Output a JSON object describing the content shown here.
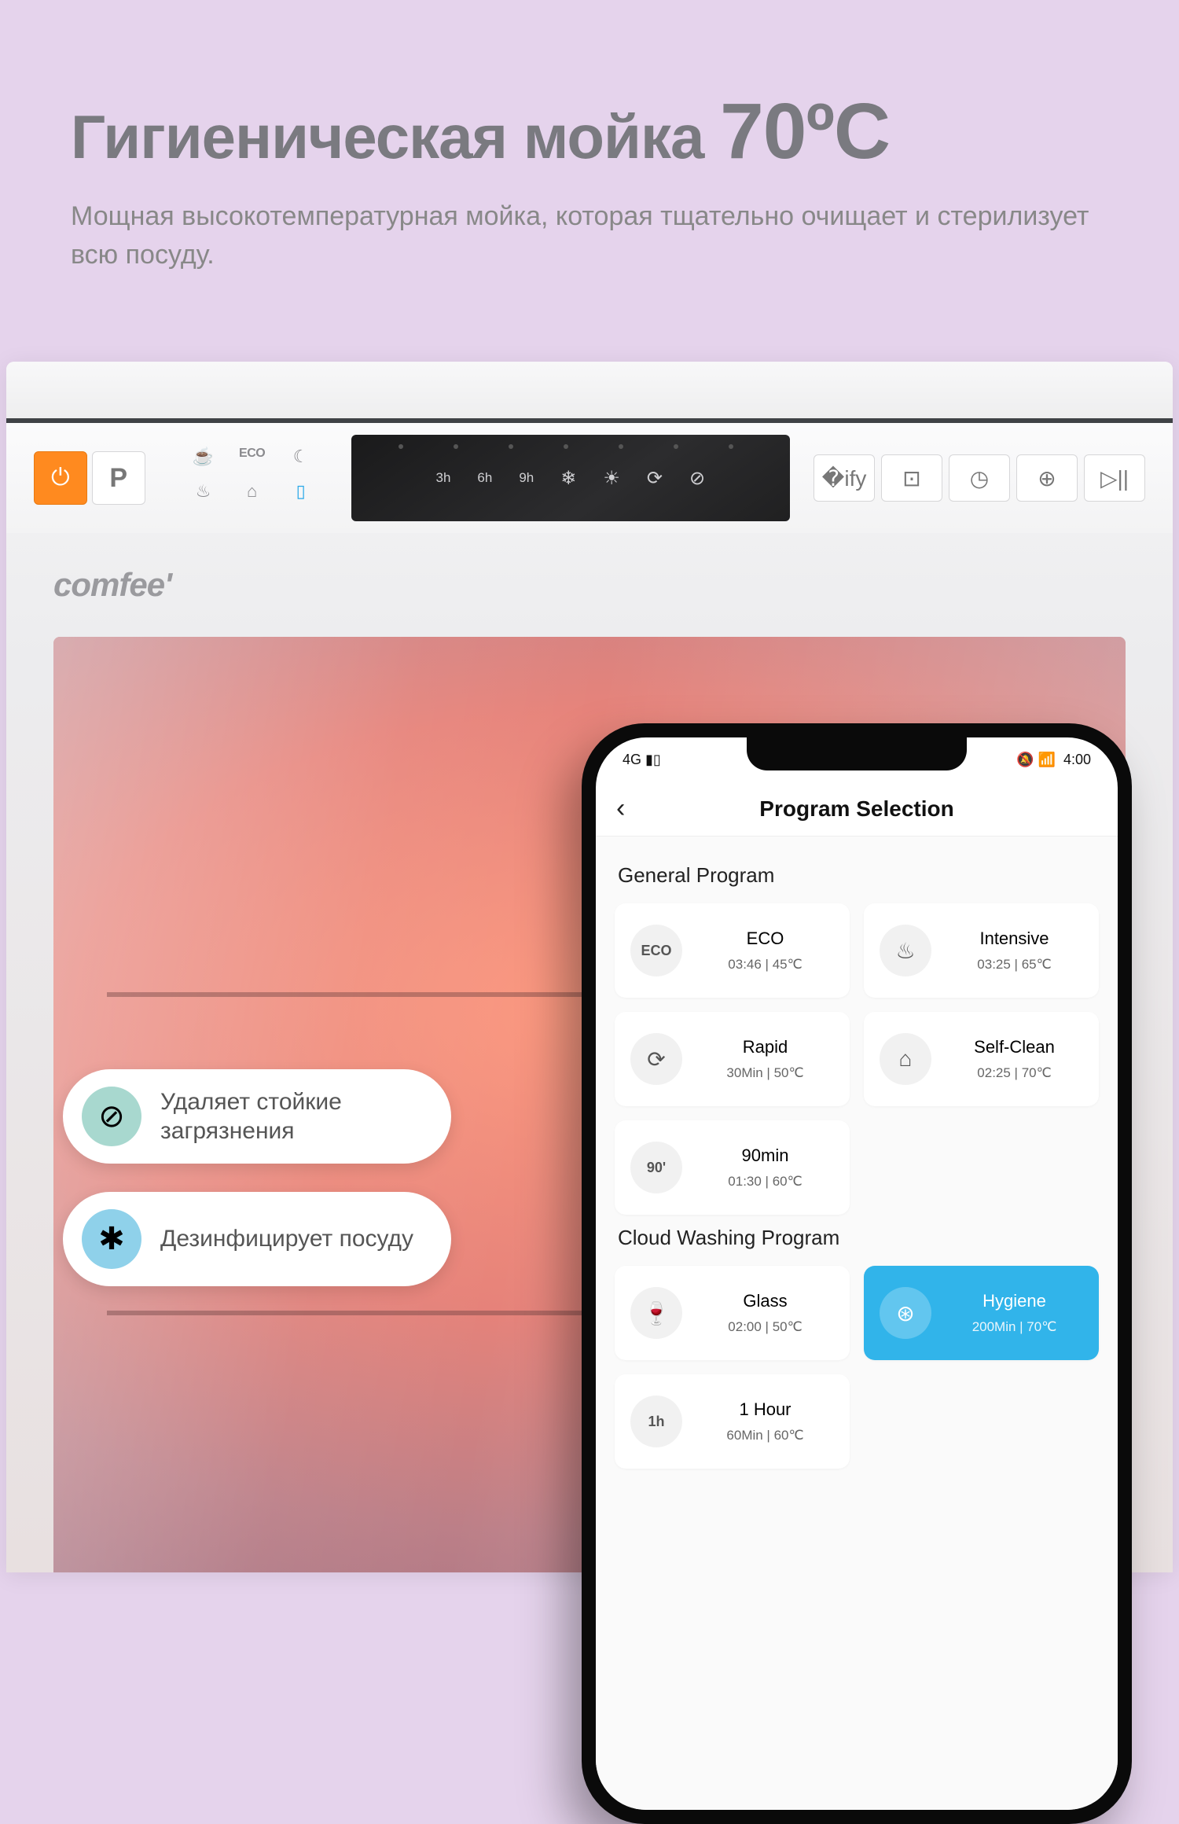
{
  "hero": {
    "title_main": "Гигиеническая мойка",
    "title_temp": "70ºC",
    "description": "Мощная высокотемпературная мойка, которая тщательно очищает и стерилизует всю посуду."
  },
  "appliance": {
    "brand": "comfee'",
    "power_icon": "⏻",
    "p_label": "P",
    "icons": {
      "eco": "ECO",
      "cup": "☕",
      "moon": "☾",
      "pot": "♨",
      "basket": "⌂",
      "phone": "▯"
    },
    "display_labels": [
      "3h",
      "6h",
      "9h",
      "❄",
      "☀",
      "⟳",
      "⊘"
    ],
    "right_buttons": [
      "�ify",
      "⊡",
      "◷",
      "⊕",
      "▷||"
    ]
  },
  "pills": [
    {
      "icon_color": "#a8d8cf",
      "icon": "⊘",
      "text": "Удаляет стойкие\nзагрязнения"
    },
    {
      "icon_color": "#8fd1ea",
      "icon": "✱",
      "text": "Дезинфицирует посуду"
    }
  ],
  "phone": {
    "status_left": "4G ▮▯",
    "status_right_icons": "🔕 📶",
    "status_time": "4:00",
    "back": "‹",
    "header": "Program Selection",
    "sections": [
      {
        "title": "General Program",
        "programs": [
          {
            "icon": "ECO",
            "icon_class": "ecot",
            "name": "ECO",
            "detail": "03:46 | 45℃"
          },
          {
            "icon": "♨",
            "name": "Intensive",
            "detail": "03:25 | 65℃"
          },
          {
            "icon": "⟳",
            "name": "Rapid",
            "detail": "30Min | 50℃"
          },
          {
            "icon": "⌂",
            "name": "Self-Clean",
            "detail": "02:25 | 70℃"
          },
          {
            "icon": "90'",
            "icon_class": "ecot",
            "name": "90min",
            "detail": "01:30 | 60℃"
          },
          {
            "empty": true
          }
        ]
      },
      {
        "title": "Cloud Washing Program",
        "programs": [
          {
            "icon": "🍷",
            "name": "Glass",
            "detail": "02:00 | 50℃"
          },
          {
            "icon": "⊛",
            "name": "Hygiene",
            "detail": "200Min | 70℃",
            "selected": true
          },
          {
            "icon": "1h",
            "icon_class": "ecot",
            "name": "1 Hour",
            "detail": "60Min | 60℃"
          }
        ]
      }
    ]
  }
}
